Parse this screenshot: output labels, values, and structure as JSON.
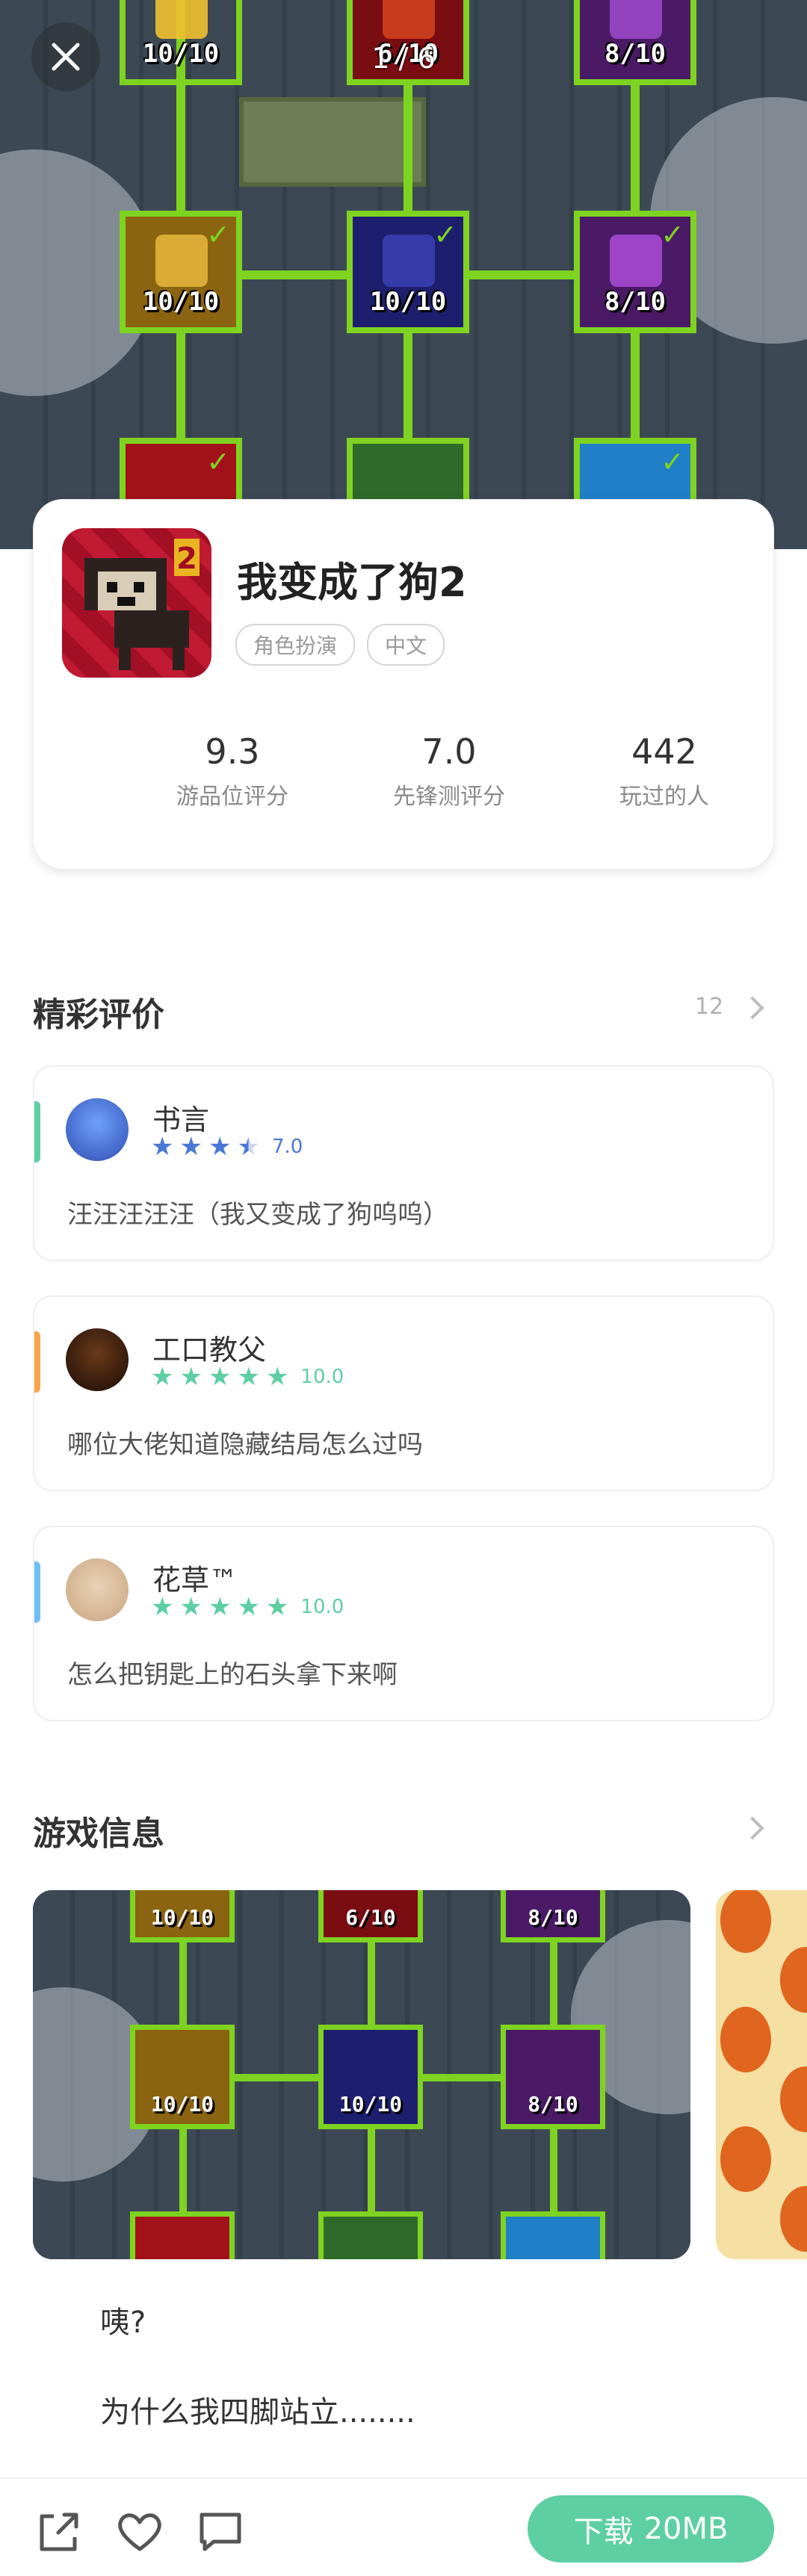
{
  "hero": {
    "pager": "1 / 6",
    "tiles": [
      {
        "count": "10/10",
        "checked": true,
        "color": "#d9a21a"
      },
      {
        "count": "6/10",
        "checked": true,
        "color": "#c0161d"
      },
      {
        "count": "8/10",
        "checked": true,
        "color": "#7b2f9e"
      },
      {
        "count": "10/10",
        "checked": true,
        "color": "#d9a21a"
      },
      {
        "count": "10/10",
        "checked": true,
        "color": "#2a2d8f"
      },
      {
        "count": "8/10",
        "checked": true,
        "color": "#7b2f9e"
      }
    ]
  },
  "app": {
    "name": "我变成了狗2",
    "tags": [
      "角色扮演",
      "中文"
    ],
    "stats": [
      {
        "value": "9.3",
        "label": "游品位评分"
      },
      {
        "value": "7.0",
        "label": "先锋测评分"
      },
      {
        "value": "442",
        "label": "玩过的人"
      }
    ]
  },
  "reviews_section": {
    "title": "精彩评价",
    "count": "12",
    "items": [
      {
        "user": "书言",
        "score": "7.0",
        "stars": 3.5,
        "star_color": "#4a78d6",
        "accent": "#5ecfa3",
        "text": "汪汪汪汪汪（我又变成了狗呜呜）"
      },
      {
        "user": "工口教父",
        "score": "10.0",
        "stars": 5,
        "star_color": "#5ecfa3",
        "accent": "#f5a54a",
        "text": "哪位大佬知道隐藏结局怎么过吗"
      },
      {
        "user": "花草™",
        "score": "10.0",
        "stars": 5,
        "star_color": "#5ecfa3",
        "accent": "#6fc0f0",
        "text": "怎么把钥匙上的石头拿下来啊"
      }
    ]
  },
  "info_section": {
    "title": "游戏信息",
    "gallery_tiles": [
      "10/10",
      "6/10",
      "8/10",
      "10/10",
      "10/10",
      "8/10"
    ],
    "description": [
      "咦?",
      "为什么我四脚站立........"
    ]
  },
  "bottom_bar": {
    "download_label": "下载",
    "download_size": "20MB"
  }
}
